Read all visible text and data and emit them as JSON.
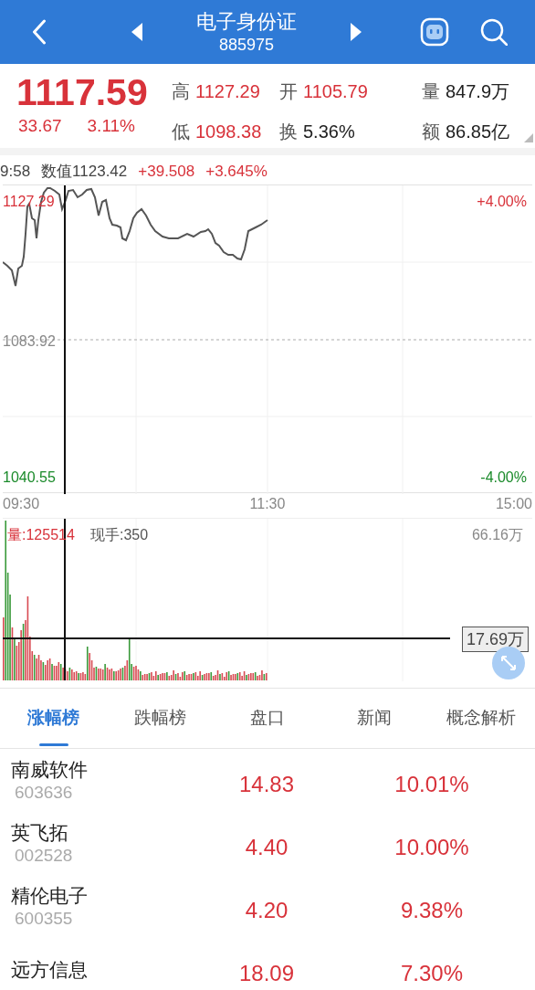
{
  "header": {
    "title": "电子身份证",
    "code": "885975"
  },
  "quote": {
    "price": "1117.59",
    "change": "33.67",
    "change_pct": "3.11%"
  },
  "stats": [
    {
      "label": "高",
      "value": "1127.29",
      "color": "#d8323a"
    },
    {
      "label": "开",
      "value": "1105.79",
      "color": "#d8323a"
    },
    {
      "label": "量",
      "value": "847.9万",
      "color": "#222222"
    },
    {
      "label": "低",
      "value": "1098.38",
      "color": "#d8323a"
    },
    {
      "label": "换",
      "value": "5.36%",
      "color": "#222222"
    },
    {
      "label": "额",
      "value": "86.85亿",
      "color": "#222222"
    }
  ],
  "cursor_info": {
    "time": "9:58",
    "value": "数值1123.42",
    "change": "+39.508",
    "change_pct": "+3.645%"
  },
  "price_chart": {
    "high": "1127.29",
    "high_pct": "+4.00%",
    "mid": "1083.92",
    "low": "1040.55",
    "low_pct": "-4.00%"
  },
  "times": [
    "09:30",
    "11:30",
    "15:00"
  ],
  "volume_chart": {
    "volume": "量:125514",
    "current_hand": "现手:350",
    "max": "66.16万",
    "cursor_value": "17.69万"
  },
  "tabs": [
    {
      "label": "涨幅榜",
      "selected": true
    },
    {
      "label": "跌幅榜",
      "selected": false
    },
    {
      "label": "盘口",
      "selected": false
    },
    {
      "label": "新闻",
      "selected": false
    },
    {
      "label": "概念解析",
      "selected": false
    }
  ],
  "rows": [
    {
      "name": "南威软件",
      "code": "603636",
      "price": "14.83",
      "change_pct": "10.01%"
    },
    {
      "name": "英飞拓",
      "code": "002528",
      "price": "4.40",
      "change_pct": "10.00%"
    },
    {
      "name": "精伦电子",
      "code": "600355",
      "price": "4.20",
      "change_pct": "9.38%"
    },
    {
      "name": "远方信息",
      "price": "18.09",
      "change_pct": "7.30%"
    }
  ]
}
